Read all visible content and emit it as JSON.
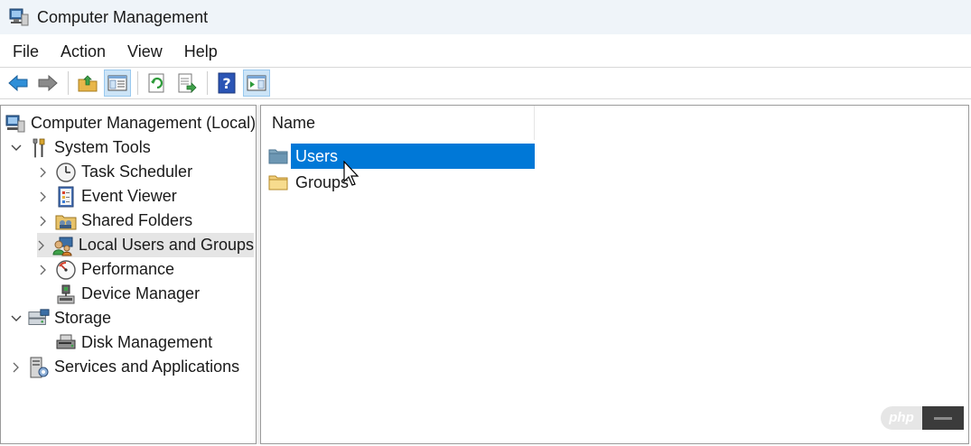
{
  "window": {
    "title": "Computer Management"
  },
  "menu": [
    "File",
    "Action",
    "View",
    "Help"
  ],
  "toolbar": {
    "buttons": [
      {
        "icon": "back-arrow-icon"
      },
      {
        "icon": "forward-arrow-icon"
      },
      {
        "icon": "up-folder-icon"
      },
      {
        "icon": "show-hide-console-tree-icon",
        "toggled": true
      },
      {
        "icon": "refresh-icon"
      },
      {
        "icon": "export-list-icon"
      },
      {
        "icon": "help-icon"
      },
      {
        "icon": "show-hide-action-pane-icon",
        "toggled": true
      }
    ]
  },
  "tree": {
    "root": "Computer Management (Local)",
    "system_tools": "System Tools",
    "task_scheduler": "Task Scheduler",
    "event_viewer": "Event Viewer",
    "shared_folders": "Shared Folders",
    "local_users_groups": "Local Users and Groups",
    "performance": "Performance",
    "device_manager": "Device Manager",
    "storage": "Storage",
    "disk_management": "Disk Management",
    "services_apps": "Services and Applications",
    "selected": "Local Users and Groups"
  },
  "list": {
    "column_name": "Name",
    "items": [
      {
        "label": "Users",
        "selected": true
      },
      {
        "label": "Groups",
        "selected": false
      }
    ]
  },
  "watermark": {
    "text": "php"
  },
  "colors": {
    "selection": "#0078d7",
    "titlebar": "#eff4f9",
    "tree_selection": "#e5e5e5"
  }
}
